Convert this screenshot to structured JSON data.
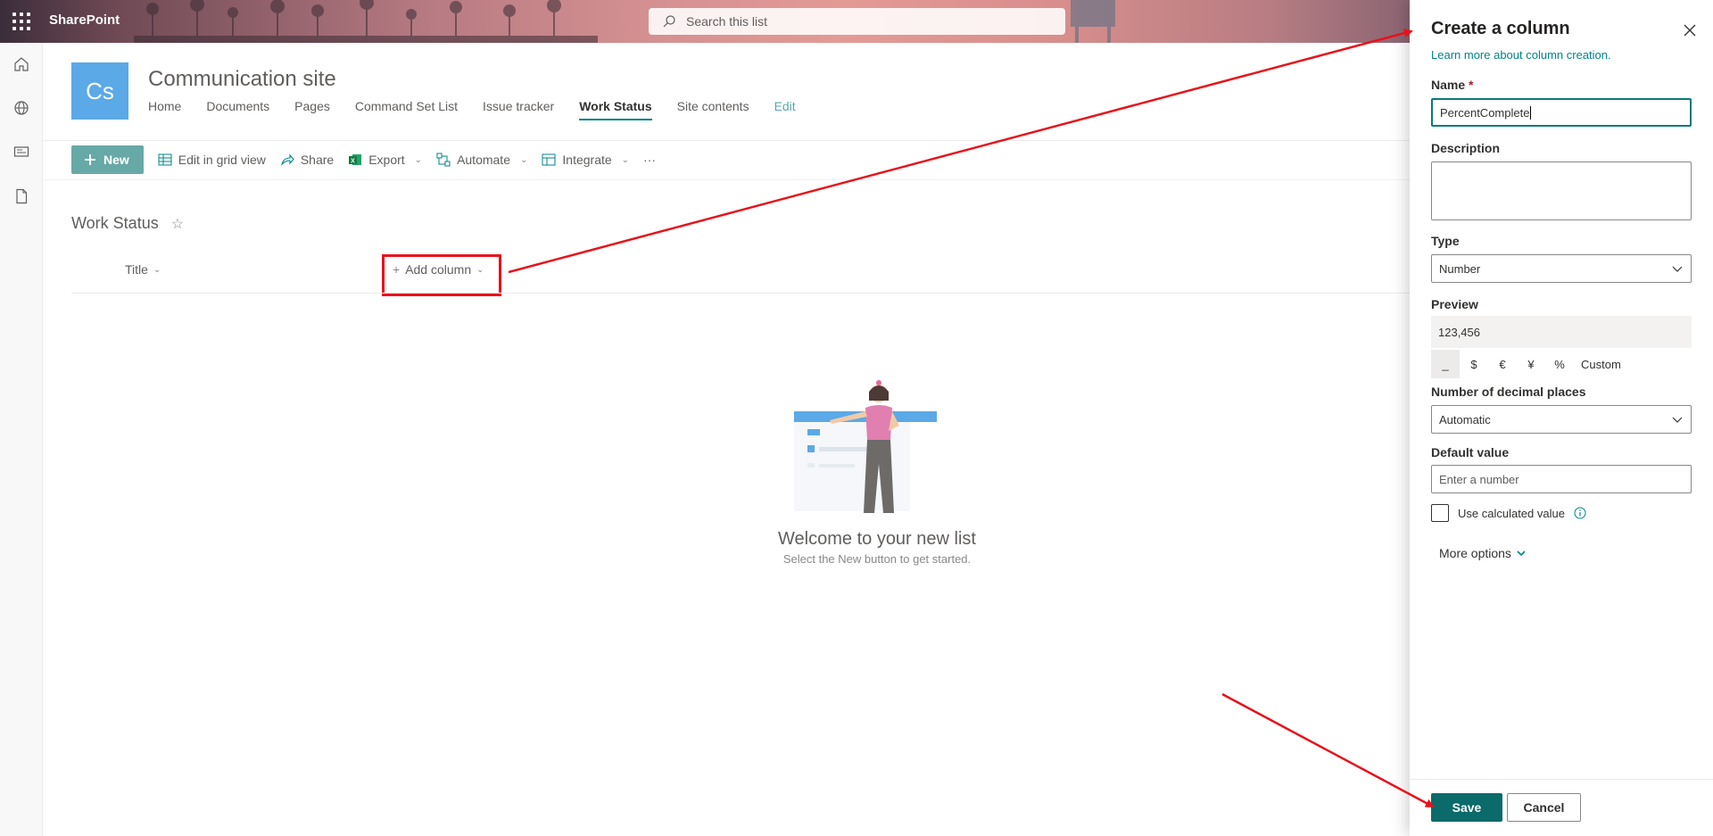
{
  "suite_bar": {
    "app_name": "SharePoint",
    "search_placeholder": "Search this list"
  },
  "left_rail": {
    "items": [
      "home-icon",
      "globe-icon",
      "news-icon",
      "document-icon"
    ]
  },
  "site": {
    "logo_initials": "Cs",
    "title": "Communication site",
    "nav": [
      "Home",
      "Documents",
      "Pages",
      "Command Set List",
      "Issue tracker",
      "Work Status",
      "Site contents",
      "Edit"
    ],
    "active_nav": "Work Status"
  },
  "command_bar": {
    "new_label": "New",
    "edit_grid_label": "Edit in grid view",
    "share_label": "Share",
    "export_label": "Export",
    "automate_label": "Automate",
    "integrate_label": "Integrate",
    "more_label": "···"
  },
  "list": {
    "title": "Work Status",
    "columns": [
      "Title",
      "Add column"
    ],
    "empty_title": "Welcome to your new list",
    "empty_subtitle": "Select the New button to get started."
  },
  "panel": {
    "title": "Create a column",
    "learn_more": "Learn more about column creation.",
    "name_label": "Name",
    "required_marker": "*",
    "name_value": "PercentComplete",
    "description_label": "Description",
    "type_label": "Type",
    "type_value": "Number",
    "preview_label": "Preview",
    "preview_value": "123,456",
    "formats": [
      "_",
      "$",
      "€",
      "¥",
      "%",
      "Custom"
    ],
    "selected_format": "_",
    "decimals_label": "Number of decimal places",
    "decimals_value": "Automatic",
    "default_label": "Default value",
    "default_placeholder": "Enter a number",
    "calculated_label": "Use calculated value",
    "more_options": "More options",
    "save_label": "Save",
    "cancel_label": "Cancel"
  },
  "colors": {
    "accent": "#038387",
    "new_button": "#67a9a7",
    "save_button": "#0b6a6a",
    "annotation": "#e8121b",
    "logo_bg": "#5ba9e6"
  }
}
